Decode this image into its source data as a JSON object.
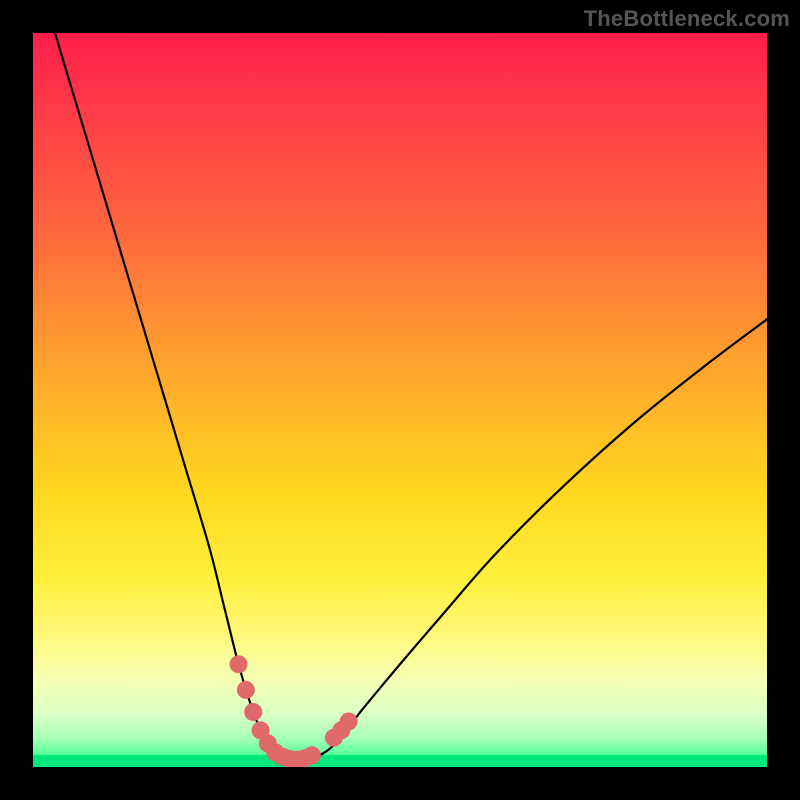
{
  "watermark": {
    "text": "TheBottleneck.com"
  },
  "colors": {
    "page_bg": "#000000",
    "curve": "#000000",
    "marker_fill": "#e06a6a",
    "marker_stroke": "#c95a5a"
  },
  "chart_data": {
    "type": "line",
    "title": "",
    "xlabel": "",
    "ylabel": "",
    "xlim": [
      0,
      100
    ],
    "ylim": [
      0,
      100
    ],
    "grid": false,
    "legend": false,
    "notes": "Axes are unlabeled in the source image; x/y are normalized 0–100 from the plot frame. Curve estimated from pixels.",
    "series": [
      {
        "name": "bottleneck-curve",
        "x": [
          3,
          6,
          9,
          12,
          15,
          18,
          21,
          24,
          26,
          28,
          29.5,
          31,
          32.5,
          34,
          36,
          38,
          41,
          45,
          50,
          56,
          63,
          72,
          82,
          92,
          100
        ],
        "y": [
          100,
          90,
          80,
          70,
          60,
          50,
          40,
          30,
          22,
          14,
          9,
          5,
          2.5,
          1.2,
          1.0,
          1.2,
          3,
          8,
          14,
          21,
          29,
          38,
          47,
          55,
          61
        ]
      }
    ],
    "markers": {
      "name": "sweet-spot-markers",
      "points": [
        {
          "x": 28.0,
          "y": 14.0
        },
        {
          "x": 29.0,
          "y": 10.5
        },
        {
          "x": 30.0,
          "y": 7.5
        },
        {
          "x": 31.0,
          "y": 5.0
        },
        {
          "x": 32.0,
          "y": 3.2
        },
        {
          "x": 33.0,
          "y": 2.0
        },
        {
          "x": 34.0,
          "y": 1.4
        },
        {
          "x": 35.0,
          "y": 1.1
        },
        {
          "x": 36.0,
          "y": 1.0
        },
        {
          "x": 37.0,
          "y": 1.2
        },
        {
          "x": 38.0,
          "y": 1.6
        },
        {
          "x": 41.0,
          "y": 4.0
        },
        {
          "x": 42.0,
          "y": 5.0
        },
        {
          "x": 43.0,
          "y": 6.2
        }
      ]
    }
  }
}
